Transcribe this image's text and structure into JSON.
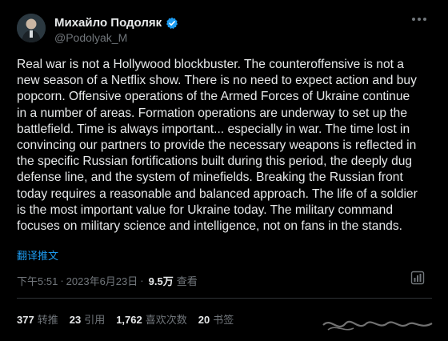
{
  "author": {
    "name": "Михайло Подоляк",
    "handle": "@Podolyak_M"
  },
  "tweet": {
    "text": "Real war is not a Hollywood blockbuster. The counteroffensive is not a\nnew season of a Netflix show. There is no need to expect action and buy\npopcorn. Offensive operations of the Armed Forces of Ukraine continue\nin a number of areas. Formation operations are underway to set up the\nbattlefield. Time is always important... especially in war. The time lost in\nconvincing our partners to provide the necessary weapons is reflected in\nthe specific Russian fortifications built during this period, the deeply dug\ndefense line, and the system of minefields. Breaking the Russian front\ntoday requires a reasonable and balanced approach. The life of a soldier\nis the most important value for Ukraine today. The military command\nfocuses on military science and intelligence, not on fans in the stands.",
    "translate_label": "翻译推文"
  },
  "meta": {
    "time": "下午5:51",
    "separator": "·",
    "date": "2023年6月23日",
    "views": "9.5万",
    "views_label": "查看"
  },
  "stats": [
    {
      "count": "377",
      "label": "转推"
    },
    {
      "count": "23",
      "label": "引用"
    },
    {
      "count": "1,762",
      "label": "喜欢次数"
    },
    {
      "count": "20",
      "label": "书签"
    }
  ],
  "icons": {
    "verified": "verified-badge-icon",
    "more": "more-options-icon",
    "analytics": "analytics-chart-icon"
  },
  "colors": {
    "background": "#000000",
    "text": "#e7e9ea",
    "secondary": "#71767b",
    "accent": "#1d9bf0"
  }
}
